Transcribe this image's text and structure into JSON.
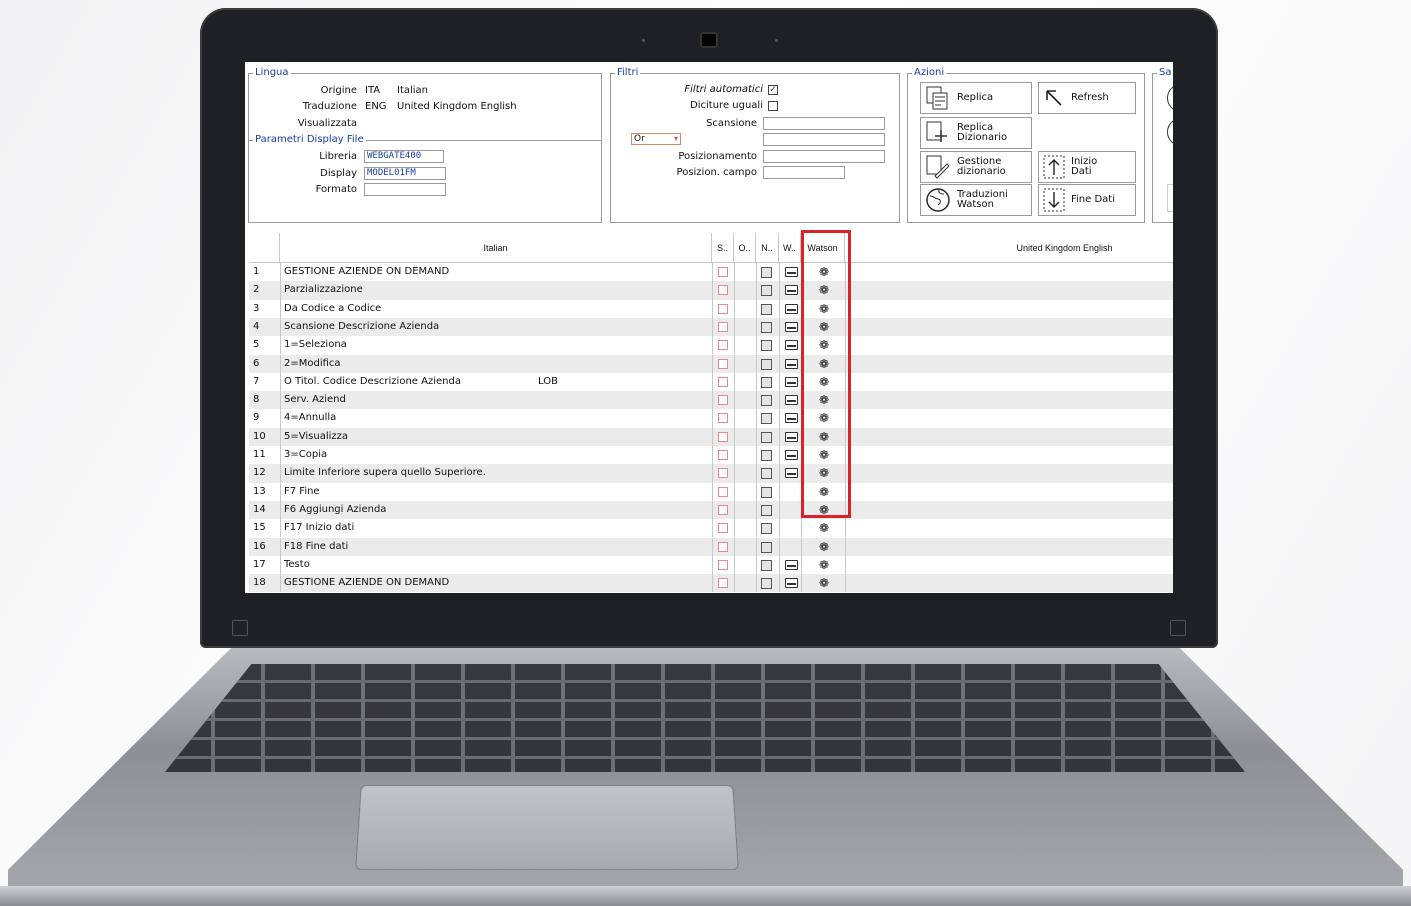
{
  "lingua": {
    "legend": "Lingua",
    "origine_label": "Origine",
    "origine_code": "ITA",
    "origine_name": "Italian",
    "traduzione_label": "Traduzione",
    "traduzione_code": "ENG",
    "traduzione_name": "United Kingdom English",
    "visualizzata_label": "Visualizzata"
  },
  "parametri": {
    "legend": "Parametri Display File",
    "libreria_label": "Libreria",
    "libreria_value": "WEBGATE400",
    "display_label": "Display",
    "display_value": "MODEL01FM",
    "formato_label": "Formato",
    "formato_value": ""
  },
  "filtri": {
    "legend": "Filtri",
    "automatici_label": "Filtri automatici",
    "automatici_checked": "✓",
    "diciture_label": "Diciture uguali",
    "scansione_label": "Scansione",
    "operator": "Or",
    "posizionamento_label": "Posizionamento",
    "posizion_campo_label": "Posizion. campo"
  },
  "azioni": {
    "legend": "Azioni",
    "replica": "Replica",
    "refresh": "Refresh",
    "replica_dizionario": "Replica\nDizionario",
    "gestione_dizionario": "Gestione\ndizionario",
    "inizio_dati": "Inizio\nDati",
    "traduzioni_watson": "Traduzioni\nWatson",
    "fine_dati": "Fine Dati"
  },
  "sa_legend": "Sa",
  "table": {
    "headers": {
      "italian": "Italian",
      "s": "S..",
      "o": "O..",
      "n": "N..",
      "w": "W..",
      "watson": "Watson",
      "english": "United Kingdom English"
    },
    "rows": [
      {
        "n": "1",
        "text": "GESTIONE AZIENDE ON DEMAND",
        "extra": "",
        "w": true
      },
      {
        "n": "2",
        "text": "Parzializzazione",
        "extra": "",
        "w": true
      },
      {
        "n": "3",
        "text": "Da Codice a Codice",
        "extra": "",
        "w": true
      },
      {
        "n": "4",
        "text": "Scansione Descrizione Azienda",
        "extra": "",
        "w": true
      },
      {
        "n": "5",
        "text": "1=Seleziona",
        "extra": "",
        "w": true
      },
      {
        "n": "6",
        "text": "2=Modifica",
        "extra": "",
        "w": true
      },
      {
        "n": "7",
        "text": "O Titol. Codice Descrizione Azienda",
        "extra": "LOB",
        "w": true
      },
      {
        "n": "8",
        "text": "Serv.  Aziend",
        "extra": "",
        "w": true
      },
      {
        "n": "9",
        "text": "4=Annulla",
        "extra": "",
        "w": true
      },
      {
        "n": "10",
        "text": "5=Visualizza",
        "extra": "",
        "w": true
      },
      {
        "n": "11",
        "text": "3=Copia",
        "extra": "",
        "w": true
      },
      {
        "n": "12",
        "text": "Limite Inferiore supera quello Superiore.",
        "extra": "",
        "w": true
      },
      {
        "n": "13",
        "text": "F7 Fine",
        "extra": "",
        "w": false
      },
      {
        "n": "14",
        "text": "F6 Aggiungi Azienda",
        "extra": "",
        "w": false
      },
      {
        "n": "15",
        "text": "F17 Inizio dati",
        "extra": "",
        "w": false
      },
      {
        "n": "16",
        "text": "F18 Fine dati",
        "extra": "",
        "w": false
      },
      {
        "n": "17",
        "text": "Testo",
        "extra": "",
        "w": true
      },
      {
        "n": "18",
        "text": "GESTIONE AZIENDE ON DEMAND",
        "extra": "",
        "w": true
      }
    ]
  },
  "accent_colors": {
    "link_blue": "#1a3ea8",
    "highlight_red": "#d8232a"
  }
}
